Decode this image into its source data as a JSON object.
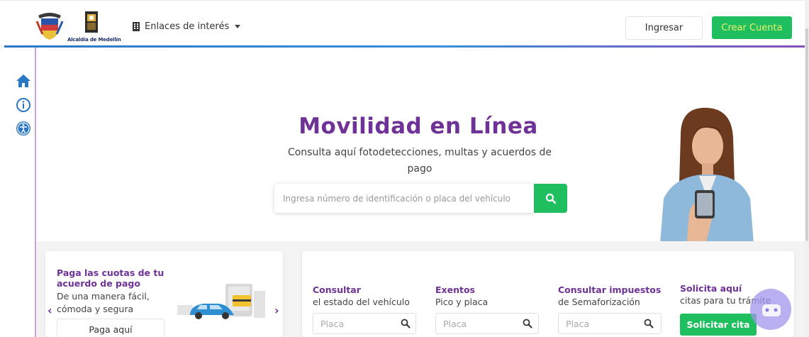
{
  "header": {
    "logo_caption": "Alcaldía de Medellín",
    "links_label": "Enlaces de interés",
    "login_label": "Ingresar",
    "signup_label": "Crear Cuenta"
  },
  "sidebar": {
    "icons": [
      "home-icon",
      "info-icon",
      "accessibility-icon"
    ]
  },
  "hero": {
    "title": "Movilidad en Línea",
    "subtitle": "Consulta aquí fotodetecciones, multas y acuerdos de pago",
    "search_placeholder": "Ingresa número de identificación o placa del vehículo"
  },
  "pay_card": {
    "title": "Paga las cuotas de tu acuerdo de pago",
    "description": "De una manera fácil, cómoda y segura",
    "button_label": "Paga aquí",
    "prev_arrow": "‹",
    "next_arrow": "›"
  },
  "services": {
    "consultar": {
      "title": "Consultar",
      "subtitle": "el estado del vehículo",
      "placeholder": "Placa"
    },
    "exentos": {
      "title": "Exentos",
      "subtitle": "Pico y placa",
      "placeholder": "Placa"
    },
    "impuestos": {
      "title": "Consultar impuestos",
      "subtitle": "de Semaforización",
      "placeholder": "Placa"
    },
    "citas": {
      "title": "Solicita aquí",
      "subtitle": "citas para tu trámite",
      "button_label": "Solicitar cita"
    }
  },
  "colors": {
    "brand_purple": "#6f3296",
    "brand_green": "#1fbe5e",
    "header_blue": "#2a78c5"
  }
}
